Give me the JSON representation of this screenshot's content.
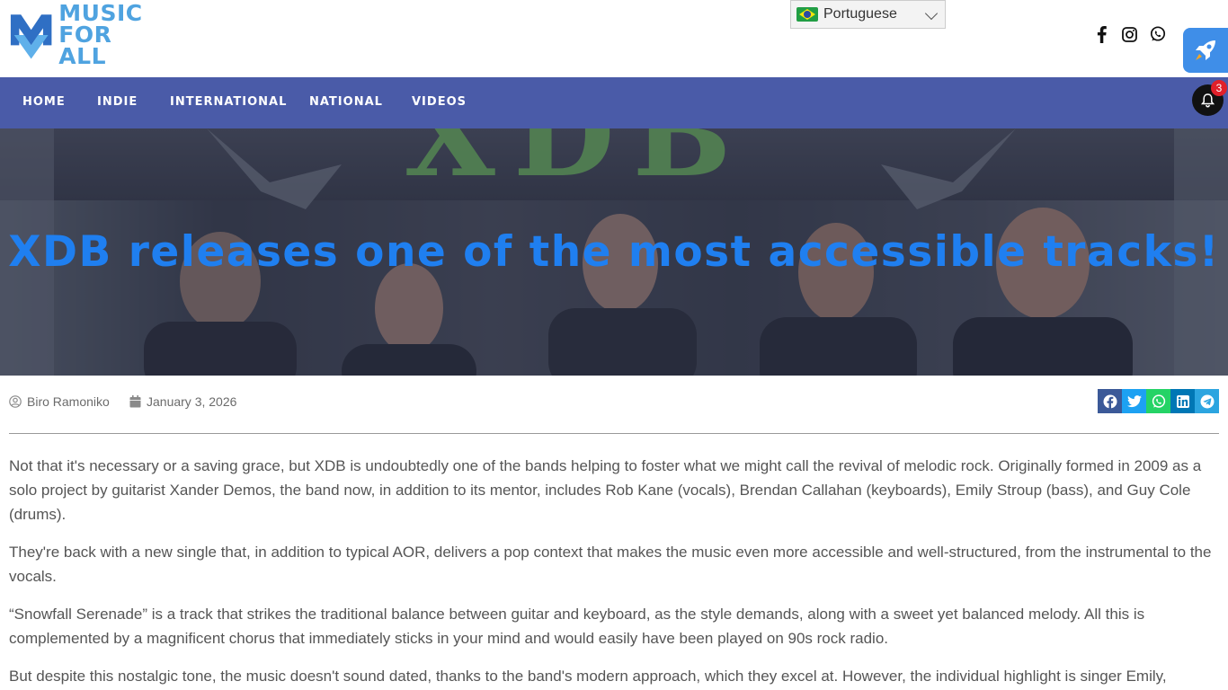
{
  "header": {
    "logo": {
      "line1": "MUSIC",
      "line2": "FOR ALL"
    },
    "language": {
      "selected": "Portuguese"
    },
    "social_icons": [
      "facebook-icon",
      "instagram-icon",
      "whatsapp-icon"
    ]
  },
  "nav": {
    "items": [
      {
        "label": "HOME"
      },
      {
        "label": "INDIE"
      },
      {
        "label": "INTERNATIONAL"
      },
      {
        "label": "NATIONAL"
      },
      {
        "label": "VIDEOS"
      }
    ],
    "notifications": "3"
  },
  "hero": {
    "title": "XDB releases one of the most accessible tracks!",
    "image_text": "XDB"
  },
  "meta": {
    "author": "Biro Ramoniko",
    "date": "January 3, 2026"
  },
  "share_buttons": [
    {
      "icon": "facebook-icon",
      "color": "#3b5998"
    },
    {
      "icon": "twitter-icon",
      "color": "#1da1f2"
    },
    {
      "icon": "whatsapp-icon",
      "color": "#25d366"
    },
    {
      "icon": "linkedin-icon",
      "color": "#0077b5"
    },
    {
      "icon": "telegram-icon",
      "color": "#2ca5e0"
    }
  ],
  "article": {
    "paragraphs": [
      "Not that it's necessary or a saving grace, but XDB is undoubtedly one of the bands helping to foster what we might call the revival of melodic rock. Originally formed in 2009 as a solo project by guitarist Xander Demos, the band now, in addition to its mentor, includes Rob Kane (vocals), Brendan Callahan (keyboards), Emily Stroup (bass), and Guy Cole (drums).",
      "They're back with a new single that, in addition to typical AOR, delivers a pop context that makes the music even more accessible and well-structured, from the instrumental to the vocals.",
      "“Snowfall Serenade” is a track that strikes the traditional balance between guitar and keyboard, as the style demands, along with a sweet yet balanced melody. All this is complemented by a magnificent chorus that immediately sticks in your mind and would easily have been played on 90s rock radio.",
      "But despite this nostalgic tone, the music doesn't sound dated, thanks to the band's modern approach, which they excel at. However, the individual highlight is singer Emily,"
    ]
  },
  "colors": {
    "nav_bg": "#4a5ba8",
    "title_blue": "#1f7ff0",
    "logo_blue": "#4fa3e0"
  }
}
